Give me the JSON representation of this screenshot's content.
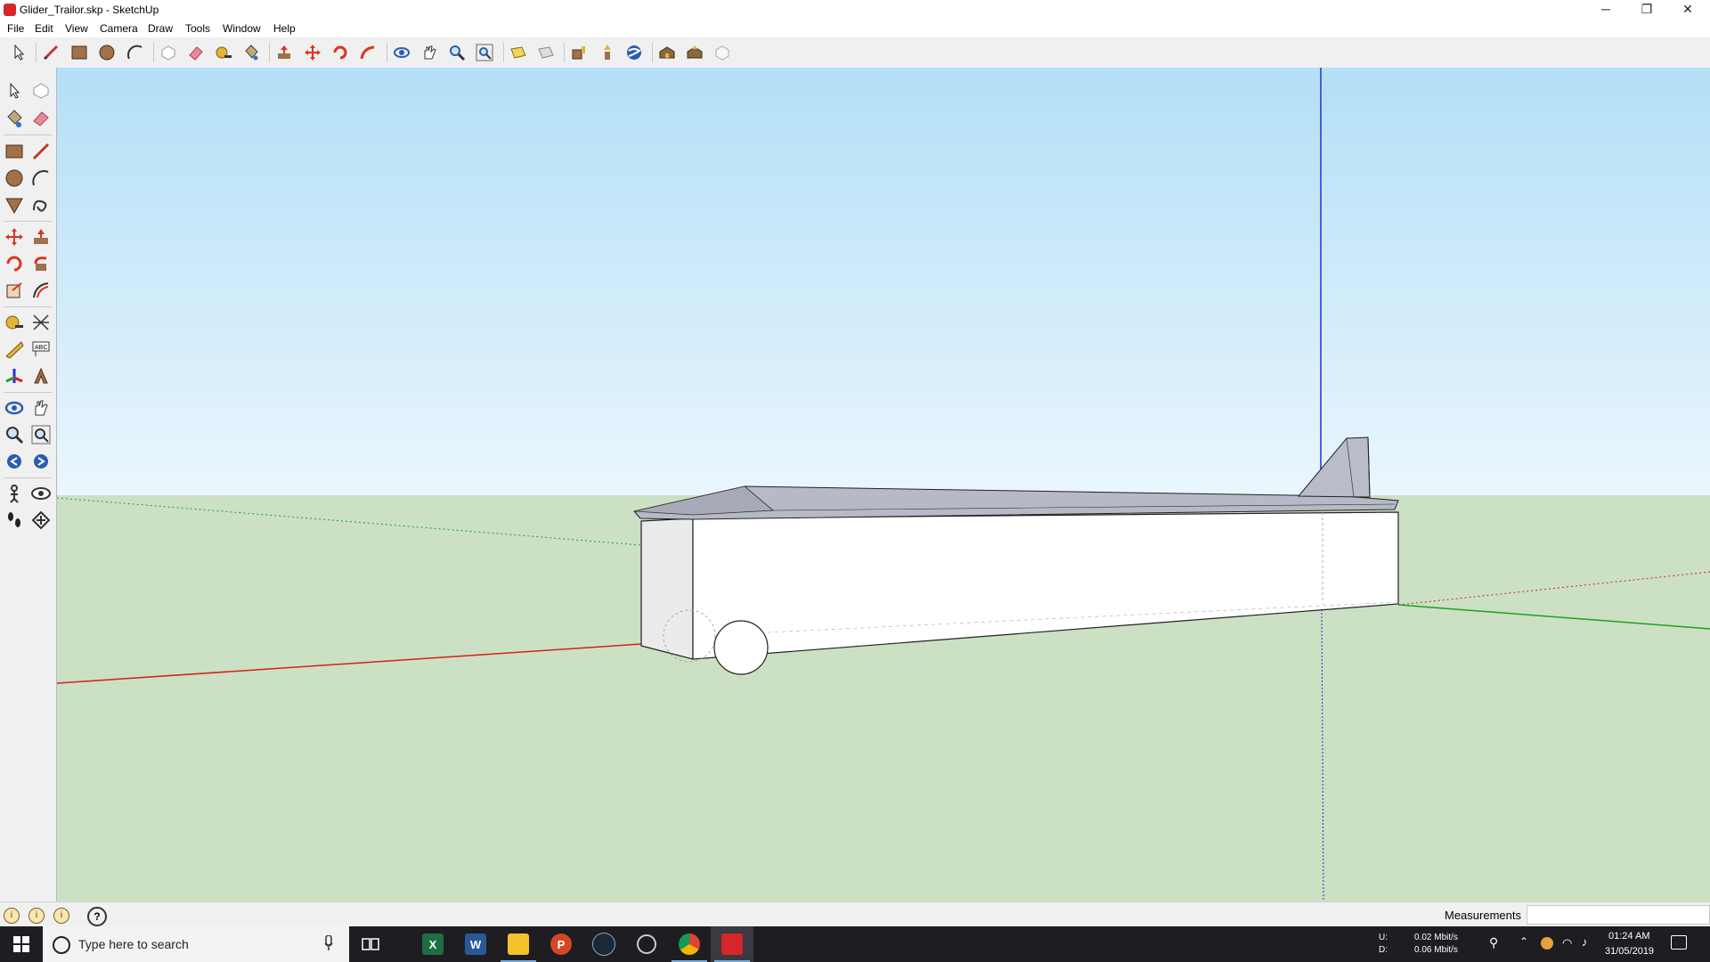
{
  "window": {
    "title": "Glider_Trailor.skp - SketchUp"
  },
  "menu": [
    "File",
    "Edit",
    "View",
    "Camera",
    "Draw",
    "Tools",
    "Window",
    "Help"
  ],
  "window_controls": {
    "minimize": "─",
    "restore": "❐",
    "close": "✕"
  },
  "toolbar_top": [
    "select",
    "line",
    "rectangle",
    "circle",
    "arc",
    "make-component",
    "eraser",
    "tape-measure",
    "paint-bucket",
    "push-pull",
    "move",
    "rotate",
    "follow-me",
    "orbit",
    "pan",
    "zoom",
    "zoom-extents",
    "add-location",
    "toggle-terrain",
    "get-models",
    "share-model",
    "preview-in-google-earth",
    "extension-warehouse",
    "share-component",
    "3d-warehouse-upload"
  ],
  "toolbar_left": [
    "select",
    "make-component",
    "paint-bucket",
    "eraser",
    "rectangle",
    "line",
    "circle",
    "arc",
    "polygon",
    "freehand",
    "move",
    "push-pull",
    "rotate",
    "follow-me",
    "scale",
    "offset",
    "tape-measure",
    "dimensions",
    "protractor",
    "text",
    "axes",
    "3d-text",
    "orbit",
    "pan",
    "zoom",
    "zoom-extents",
    "previous-view",
    "next-view",
    "position-camera",
    "look-around",
    "walk",
    "section-plane"
  ],
  "statusbar": {
    "status_icons": [
      "i",
      "i",
      "i"
    ],
    "help_label": "?",
    "measurements_label": "Measurements",
    "measurements_value": ""
  },
  "taskbar": {
    "search_placeholder": "Type here to search",
    "apps": [
      {
        "name": "excel",
        "glyph": "X",
        "color": "#1d6f42"
      },
      {
        "name": "word",
        "glyph": "W",
        "color": "#2b579a"
      },
      {
        "name": "file-explorer",
        "glyph": "",
        "color": "#f3c22b"
      },
      {
        "name": "powerpoint",
        "glyph": "P",
        "color": "#d24726"
      },
      {
        "name": "steam",
        "glyph": "",
        "color": "#1b2838"
      },
      {
        "name": "speed-monitor",
        "glyph": "",
        "color": "#1d1d22"
      },
      {
        "name": "chrome",
        "glyph": "",
        "color": "#db4437"
      },
      {
        "name": "sketchup",
        "glyph": "",
        "color": "#d6262b"
      }
    ],
    "network": {
      "up_label": "U:",
      "down_label": "D:",
      "up": "0.02 Mbit/s",
      "down": "0.06 Mbit/s"
    },
    "time": "01:24 AM",
    "date": "31/05/2019"
  },
  "colors": {
    "sky_top": "#b3dff7",
    "sky_bottom": "#eaf6fd",
    "ground": "#cce0c4",
    "axis_red": "#d42020",
    "axis_green": "#1aa51a",
    "axis_blue": "#2030d8",
    "model_roof": "#b6bac7"
  }
}
